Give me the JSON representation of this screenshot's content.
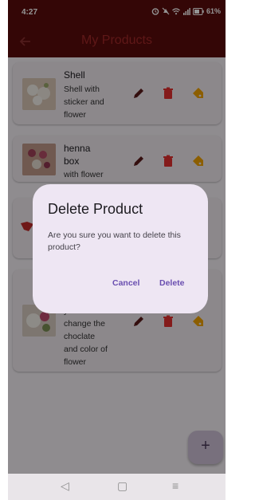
{
  "status_bar": {
    "time": "4:27",
    "battery": "61%"
  },
  "app_bar": {
    "title": "My Products"
  },
  "products": [
    {
      "name": "Shell",
      "description": [
        "Shell with",
        "sticker and",
        "flower"
      ]
    },
    {
      "name": "henna",
      "name_line2": "box",
      "description": [
        "with flower"
      ]
    },
    {
      "name": "",
      "description": []
    },
    {
      "name": "",
      "description": [
        "you can",
        "change the",
        "choclate",
        "and color of",
        "flower"
      ]
    }
  ],
  "dialog": {
    "title": "Delete Product",
    "message": "Are you sure you want to delete this product?",
    "cancel_label": "Cancel",
    "delete_label": "Delete"
  },
  "fab": {
    "label": "+"
  },
  "colors": {
    "app_bar": "#5a0b0b",
    "edit": "#5a1b1b",
    "delete": "#e3302f",
    "tag": "#f2a200",
    "accent": "#6a4fb0"
  },
  "icons": {
    "back": "arrow-left-icon",
    "edit": "pencil-icon",
    "delete": "trash-icon",
    "tag": "tag-icon"
  }
}
